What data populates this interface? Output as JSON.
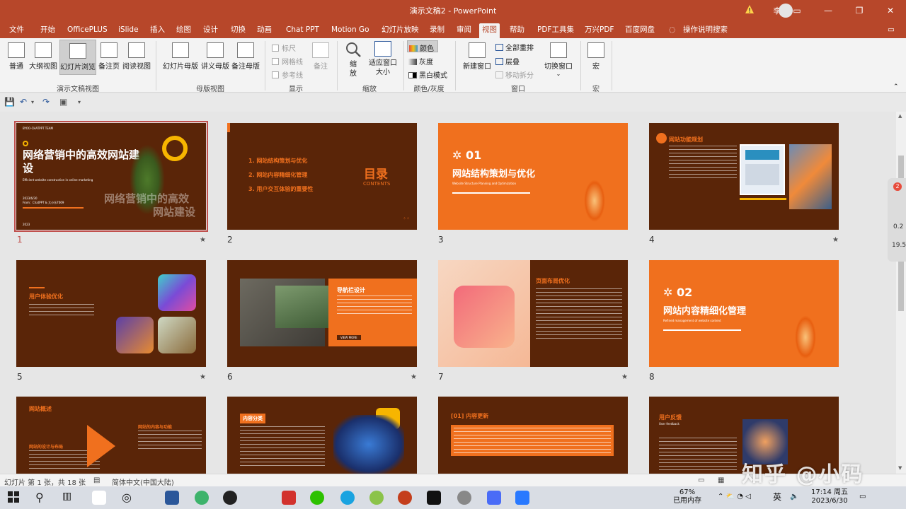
{
  "window": {
    "title": "演示文稿2 - PowerPoint",
    "user": "李 锐"
  },
  "tabs": [
    "文件",
    "开始",
    "OfficePLUS",
    "iSlide",
    "插入",
    "绘图",
    "设计",
    "切换",
    "动画",
    "Chat PPT",
    "Motion Go",
    "幻灯片放映",
    "录制",
    "审阅",
    "视图",
    "帮助",
    "PDF工具集",
    "万兴PDF",
    "百度网盘",
    "操作说明搜索"
  ],
  "ribbon": {
    "normal": "普通",
    "outline": "大纲视图",
    "sorter": "幻灯片浏览",
    "notes_page": "备注页",
    "reading": "阅读视图",
    "group_views": "演示文稿视图",
    "slide_master": "幻灯片母版",
    "handout_master": "讲义母版",
    "notes_master": "备注母版",
    "group_master": "母版视图",
    "ruler": "标尺",
    "gridlines": "网格线",
    "guides": "参考线",
    "notes": "备注",
    "group_show": "显示",
    "zoom": "缩放",
    "fit": "适应窗口大小",
    "group_zoom": "缩放",
    "color": "颜色",
    "grayscale": "灰度",
    "bw": "黑白模式",
    "group_color": "颜色/灰度",
    "new_window": "新建窗口",
    "arrange_all": "全部重排",
    "cascade": "层叠",
    "move_split": "移动拆分",
    "switch_window": "切换窗口",
    "group_window": "窗口",
    "macros": "宏",
    "group_macros": "宏"
  },
  "slides": [
    {
      "num": "1",
      "title": "网络营销中的高效网站建设",
      "sub": "Efficient website construction in online marketing",
      "team": "BYOO-CHATPPT TEAM",
      "date": "2023/6/30",
      "from": "From：ChatPPT & 大小乐7069",
      "year": "2023",
      "ghost1": "网络营销中的高效",
      "ghost2": "网站建设"
    },
    {
      "num": "2",
      "item1": "1.  网站结构策划与优化",
      "item2": "2.  网站内容精细化管理",
      "item3": "3.  用户交互体验的重要性",
      "big": "目录",
      "small": "CONTENTS"
    },
    {
      "num": "3",
      "no": "01",
      "title": "网站结构策划与优化",
      "sub": "Website Structure Planning and Optimization"
    },
    {
      "num": "4",
      "title": "网站功能规划"
    },
    {
      "num": "5",
      "title": "用户体验优化"
    },
    {
      "num": "6",
      "title": "导航栏设计",
      "btn": "VIEW MORE"
    },
    {
      "num": "7",
      "title": "页面布局优化"
    },
    {
      "num": "8",
      "no": "02",
      "title": "网站内容精细化管理",
      "sub": "Refined management of website content"
    },
    {
      "title": "网站概述",
      "t2": "网站的设计与布局",
      "t3": "网站的内容与功能"
    },
    {
      "title": "内容分类"
    },
    {
      "title": "[01] 内容更新"
    },
    {
      "title": "用户反馈",
      "sub": "User feedback"
    }
  ],
  "status": {
    "slide_info": "幻灯片 第 1 张，共 18 张",
    "language": "简体中文(中国大陆)"
  },
  "taskbar": {
    "memory_pct": "67%",
    "memory_label": "已用内存",
    "ime": "英",
    "time": "17:14 周五",
    "date": "2023/6/30"
  },
  "watermark": "知乎 @小码",
  "side_widget": {
    "badge": "2",
    "v1": "0.2",
    "v2": "19.5"
  },
  "colors": {
    "accent": "#b7472a",
    "slide_dark": "#5a2508",
    "slide_orange": "#f0701e"
  }
}
